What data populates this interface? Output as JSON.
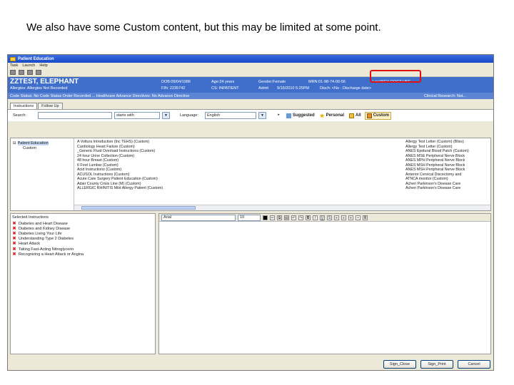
{
  "caption": "We also have some Custom content, but this may be limited at some point.",
  "window": {
    "title": "Patient Education",
    "menu": [
      "Task",
      "Launch",
      "Help"
    ]
  },
  "banner": {
    "patient_name": "ZZTEST, ELEPHANT",
    "dob": "DOB:09/04/1986",
    "age": "Age:24 years",
    "gender": "Gender:Female",
    "mrn": "MRN:01-98-74-00-56",
    "loc": "Loc:WCH DOCT USE",
    "allergies": "Allergies: Allergies Not Recorded",
    "fin": "FIN: 2235742",
    "type": "CS: INPATIENT",
    "status": "Admit",
    "admit_date": "9/16/2010 5:25PM",
    "disch": "Disch: <No - Discharge date>",
    "strip": "Code Status: No Code Status Order Recorded ... Healthcare Advance Directives: No Advance Directive",
    "strip_right": "Clinical Research: Not..."
  },
  "tabs": [
    "Instructions",
    "Follow Up"
  ],
  "search": {
    "label": "Search:",
    "mode": "starts with",
    "language_label": "Language:",
    "language": "English"
  },
  "filters": [
    "Suggested",
    "Personal",
    "All",
    "Custom"
  ],
  "tree": {
    "root": "Patient Education",
    "child": "Custom"
  },
  "list_col1": [
    "A Voltura Introduction (Inc TEHS) (Custom)",
    "Cardiology Heart Failure (Custom)",
    "_Generic Fluid Overload Instructions (Custom)",
    "24 hour Urine Collection (Custom)",
    "48 hour Breast (Custom)",
    "6 Foot Lumbar (Custom)",
    "Acid Instructions (Custom)",
    "ACUSOL Instructions (Custom)",
    "Acute Care Surgery Patient Education (Custom)",
    "Adair County Crisis Line (M) (Custom)",
    "ALLERGIC RHINITIS Mild Allergy Patient (Custom)"
  ],
  "list_col2": [
    "Allergy Test Letter (Custom) (Bliss)",
    "Allergy Test Letter (Custom)",
    "ANES Epidural Blood Patch (Custom)",
    "ANES MSE Peripheral Nerve Block",
    "ANES MPH Peripheral Nerve Block",
    "ANES MSH Peripheral Nerve Block",
    "ANES MSH Peripheral Nerve Block",
    "Anterior Cervical Discectomy and",
    "ATNCA monitor (Custom)",
    "Acheri Parkinson's Disease Care",
    "Acheri Parkinson's Disease Care"
  ],
  "selected": {
    "title": "Selected Instructions",
    "items": [
      "Diabetes and Heart Disease",
      "Diabetes and Kidney Disease",
      "Diabetes Living Your Life",
      "Understanding Type 2 Diabetes",
      "Heart Attack",
      "Taking Fast-Acting Nitroglycerin",
      "Recognizing a Heart Attack or Angina"
    ]
  },
  "editor": {
    "font": "Arial",
    "size": "10"
  },
  "buttons": [
    "Sign_Close",
    "Sign_Print",
    "Cancel"
  ],
  "colors": {
    "banner": "#3f6fcb",
    "highlight_box": "#e01010"
  }
}
